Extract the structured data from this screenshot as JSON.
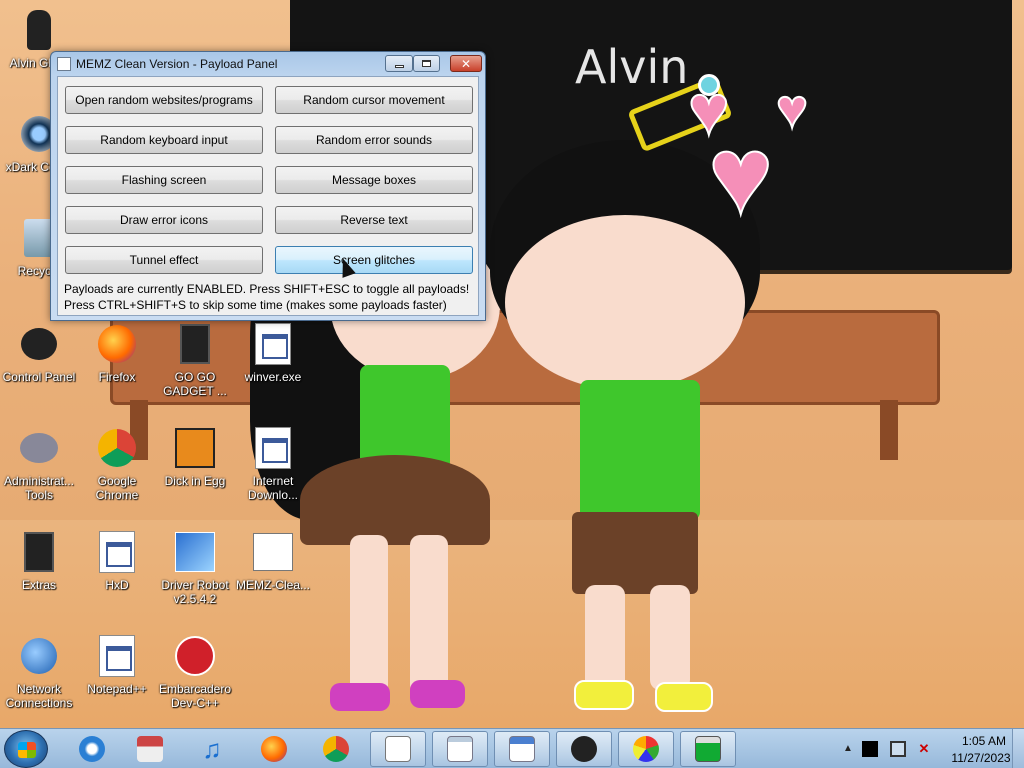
{
  "window": {
    "title": "MEMZ Clean Version - Payload Panel",
    "buttons": [
      "Open random websites/programs",
      "Random cursor movement",
      "Random keyboard input",
      "Random error sounds",
      "Flashing screen",
      "Message boxes",
      "Draw error icons",
      "Reverse text",
      "Tunnel effect",
      "Screen glitches"
    ],
    "status_line_1": "Payloads are currently ENABLED. Press SHIFT+ESC to toggle all payloads!",
    "status_line_2": "Press CTRL+SHIFT+S to skip some time (makes some payloads faster)"
  },
  "wallpaper": {
    "board_text": "Alvin"
  },
  "desktop_icons": [
    {
      "label": "Alvin Ghan",
      "icon": "user-figure-icon"
    },
    {
      "label": "xDark Cente",
      "icon": "xdark-center-icon"
    },
    {
      "label": "Recycle",
      "icon": "recycle-bin-icon"
    },
    {
      "label": "Control Panel",
      "icon": "control-panel-icon"
    },
    {
      "label": "Firefox",
      "icon": "firefox-icon"
    },
    {
      "label": "GO GO GADGET ...",
      "icon": "gadget-icon"
    },
    {
      "label": "winver.exe",
      "icon": "winver-icon"
    },
    {
      "label": "Administrat... Tools",
      "icon": "admin-tools-icon"
    },
    {
      "label": "Google Chrome",
      "icon": "chrome-icon"
    },
    {
      "label": "Dick in Egg",
      "icon": "dick-in-egg-icon"
    },
    {
      "label": "Internet Downlo...",
      "icon": "internet-download-icon"
    },
    {
      "label": "Extras",
      "icon": "extras-icon"
    },
    {
      "label": "HxD",
      "icon": "hxd-icon"
    },
    {
      "label": "Driver Robot v2.5.4.2",
      "icon": "driver-robot-icon"
    },
    {
      "label": "MEMZ-Clea...",
      "icon": "memz-icon"
    },
    {
      "label": "Network Connections",
      "icon": "network-connections-icon"
    },
    {
      "label": "Notepad++",
      "icon": "notepadpp-icon"
    },
    {
      "label": "Embarcadero Dev-C++",
      "icon": "devcpp-icon"
    }
  ],
  "taskbar": {
    "pinned": [
      "internet-explorer-icon",
      "store-icon",
      "music-icon",
      "firefox-icon",
      "chrome-icon",
      "document-icon",
      "notepad-icon",
      "wordpad-icon",
      "control-panel-icon",
      "paint-icon",
      "task-manager-icon"
    ],
    "clock_time": "1:05 AM",
    "clock_date": "11/27/2023"
  },
  "colors": {
    "taskbar": "#a8c6e3",
    "window_frame": "#bcd4ee",
    "button_hover": "#bee6fd",
    "shirt_green": "#3fc72c"
  }
}
